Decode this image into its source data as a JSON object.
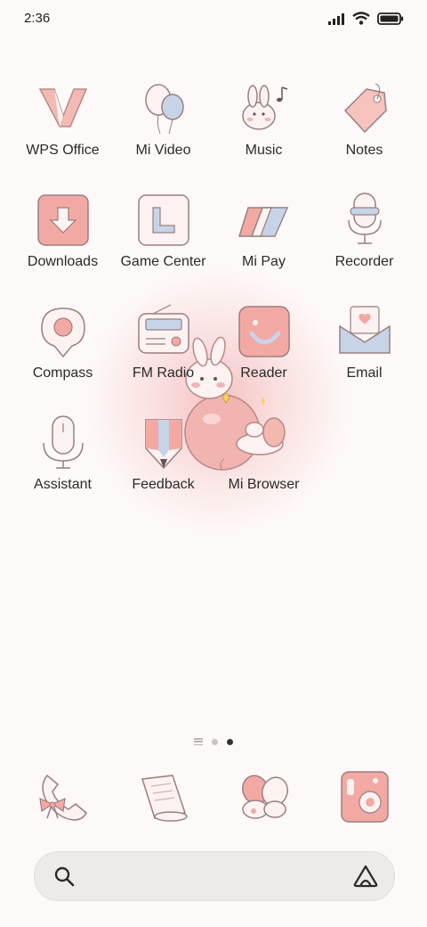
{
  "status_bar": {
    "time": "2:36"
  },
  "apps": [
    {
      "label": "WPS Office",
      "icon": "wps-office-icon"
    },
    {
      "label": "Mi Video",
      "icon": "balloons-icon"
    },
    {
      "label": "Music",
      "icon": "bunny-music-icon"
    },
    {
      "label": "Notes",
      "icon": "tag-icon"
    },
    {
      "label": "Downloads",
      "icon": "download-arrow-icon"
    },
    {
      "label": "Game Center",
      "icon": "game-center-icon"
    },
    {
      "label": "Mi Pay",
      "icon": "cards-icon"
    },
    {
      "label": "Recorder",
      "icon": "microphone-icon"
    },
    {
      "label": "Compass",
      "icon": "location-pin-icon"
    },
    {
      "label": "FM Radio",
      "icon": "radio-icon"
    },
    {
      "label": "Reader",
      "icon": "smile-icon"
    },
    {
      "label": "Email",
      "icon": "envelope-heart-icon"
    },
    {
      "label": "Assistant",
      "icon": "capsule-mic-icon"
    },
    {
      "label": "Feedback",
      "icon": "pencil-icon"
    },
    {
      "label": "Mi Browser",
      "icon": "butterfly-icon"
    }
  ],
  "dock": [
    {
      "icon": "phone-bow-icon"
    },
    {
      "icon": "scroll-icon"
    },
    {
      "icon": "butterfly-icon"
    },
    {
      "icon": "camera-icon"
    }
  ],
  "page_indicator": {
    "pages": 2,
    "current": 2
  },
  "colors": {
    "accent_pink": "#f0a8a8",
    "accent_blue": "#c7d4e8",
    "outline": "#8f6f6f",
    "background": "#fdf9f8"
  }
}
